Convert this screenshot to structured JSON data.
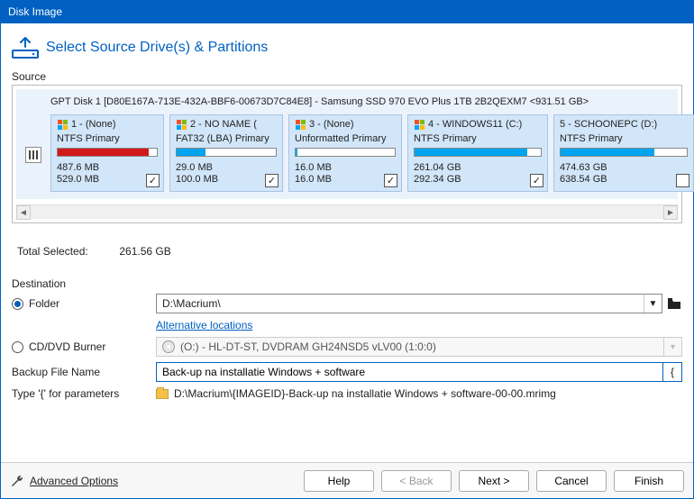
{
  "window": {
    "title": "Disk Image"
  },
  "page": {
    "heading": "Select Source Drive(s) & Partitions"
  },
  "source": {
    "label": "Source",
    "disk_desc": "GPT Disk 1 [D80E167A-713E-432A-BBF6-00673D7C84E8] - Samsung SSD 970 EVO Plus 1TB 2B2QEXM7  <931.51 GB>",
    "partitions": [
      {
        "title": "1 -  (None)",
        "fs": "NTFS Primary",
        "used": "487.6 MB",
        "total": "529.0 MB",
        "bar_color": "#d11a1a",
        "bar_pct": 92,
        "checked": true,
        "show_winflag": true
      },
      {
        "title": "2 - NO NAME (",
        "fs": "FAT32 (LBA) Primary",
        "used": "29.0 MB",
        "total": "100.0 MB",
        "bar_color": "#00a4ef",
        "bar_pct": 29,
        "checked": true,
        "show_winflag": true
      },
      {
        "title": "3 -  (None)",
        "fs": "Unformatted Primary",
        "used": "16.0 MB",
        "total": "16.0 MB",
        "bar_color": "#00a4ef",
        "bar_pct": 2,
        "checked": true,
        "show_winflag": true
      },
      {
        "title": "4 - WINDOWS11 (C:)",
        "fs": "NTFS Primary",
        "used": "261.04 GB",
        "total": "292.34 GB",
        "bar_color": "#00a4ef",
        "bar_pct": 89,
        "checked": true,
        "show_winflag": true
      },
      {
        "title": "5 - SCHOONEPC (D:)",
        "fs": "NTFS Primary",
        "used": "474.63 GB",
        "total": "638.54 GB",
        "bar_color": "#00a4ef",
        "bar_pct": 74,
        "checked": false,
        "show_winflag": false
      }
    ],
    "total_label": "Total Selected:",
    "total_value": "261.56 GB"
  },
  "destination": {
    "label": "Destination",
    "folder_radio": "Folder",
    "folder_value": "D:\\Macrium\\",
    "alt_link": "Alternative locations",
    "burner_radio": "CD/DVD Burner",
    "burner_value": "(O:) - HL-DT-ST, DVDRAM GH24NSD5  vLV00 (1:0:0)",
    "filename_label": "Backup File Name",
    "filename_value": "Back-up na installatie Windows + software",
    "type_label": "Type '{' for parameters",
    "type_value": "D:\\Macrium\\{IMAGEID}-Back-up na installatie Windows + software-00-00.mrimg"
  },
  "bottom": {
    "advanced": "Advanced Options",
    "help": "Help",
    "back": "< Back",
    "next": "Next >",
    "cancel": "Cancel",
    "finish": "Finish"
  }
}
